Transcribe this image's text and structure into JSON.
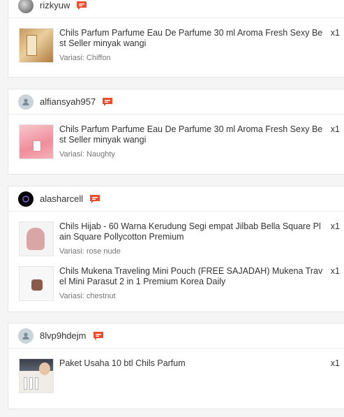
{
  "orders": [
    {
      "username": "rizkyuw",
      "items": [
        {
          "name": "Chils Parfum Parfume Eau De Parfume 30 ml Aroma Fresh Sexy Best Seller minyak wangi",
          "variant": "Variasi: Chiffon",
          "qty": "x1"
        }
      ]
    },
    {
      "username": "alfiansyah957",
      "items": [
        {
          "name": "Chils Parfum Parfume Eau De Parfume 30 ml Aroma Fresh Sexy Best Seller minyak wangi",
          "variant": "Variasi: Naughty",
          "qty": "x1"
        }
      ]
    },
    {
      "username": "alasharcell",
      "items": [
        {
          "name": "Chils Hijab - 60 Warna Kerudung Segi empat Jilbab Bella Square Plain Square Pollycotton Premium",
          "variant": "Variasi: rose nude",
          "qty": "x1"
        },
        {
          "name": "Chils Mukena Traveling Mini Pouch (FREE SAJADAH) Mukena Travel Mini Parasut 2 in 1 Premium Korea Daily",
          "variant": "Variasi: chestnut",
          "qty": "x1"
        }
      ]
    },
    {
      "username": "8lvp9hdejm",
      "items": [
        {
          "name": "Paket Usaha 10 btl Chils Parfum",
          "qty": "x1"
        }
      ]
    }
  ],
  "icons": {
    "chat": "chat-bubble-icon",
    "avatar_default": "user-avatar-icon"
  },
  "colors": {
    "chat_icon": "#ee4d2d"
  }
}
